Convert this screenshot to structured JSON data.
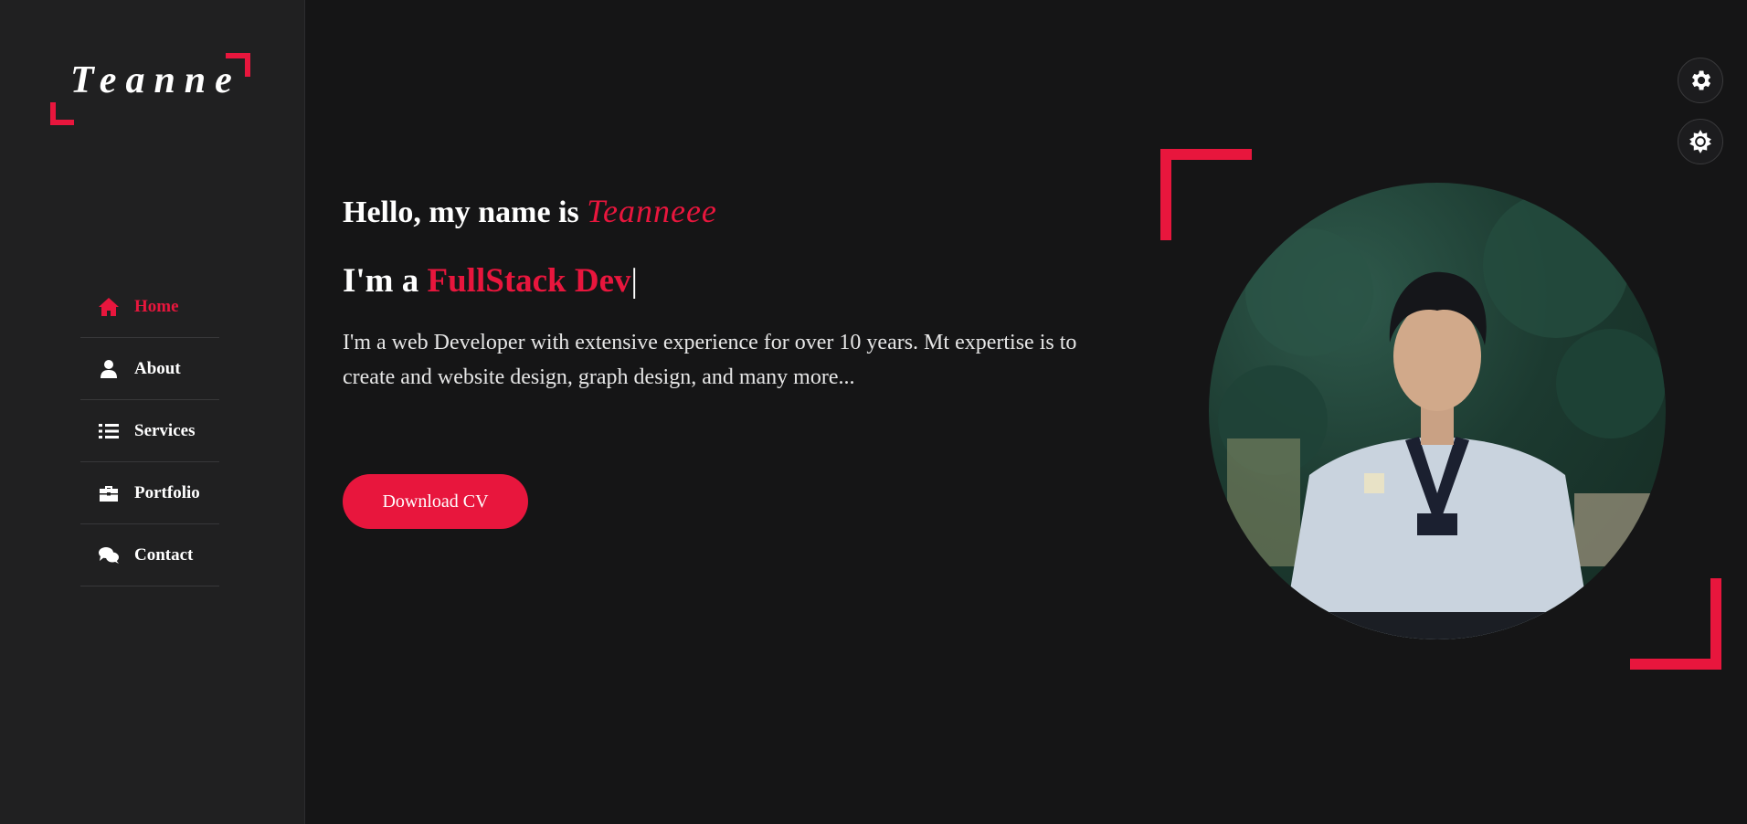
{
  "brand": {
    "logo_text": "Teanne"
  },
  "nav": {
    "items": [
      {
        "label": "Home",
        "icon": "home-icon",
        "active": true
      },
      {
        "label": "About",
        "icon": "user-icon",
        "active": false
      },
      {
        "label": "Services",
        "icon": "list-icon",
        "active": false
      },
      {
        "label": "Portfolio",
        "icon": "briefcase-icon",
        "active": false
      },
      {
        "label": "Contact",
        "icon": "chat-icon",
        "active": false
      }
    ]
  },
  "hero": {
    "greeting": "Hello, my name is ",
    "name": "Teanneee",
    "role_prefix": "I'm a ",
    "role": "FullStack Dev",
    "cursor": "|",
    "description": "I'm a web Developer with extensive experience for over 10 years. Mt expertise is to create and website design, graph design, and many more...",
    "cta_label": "Download CV"
  },
  "controls": {
    "settings_icon": "gear-icon",
    "theme_icon": "sun-icon"
  },
  "colors": {
    "accent": "#e8163d",
    "background": "#151516",
    "sidebar": "#202021"
  }
}
